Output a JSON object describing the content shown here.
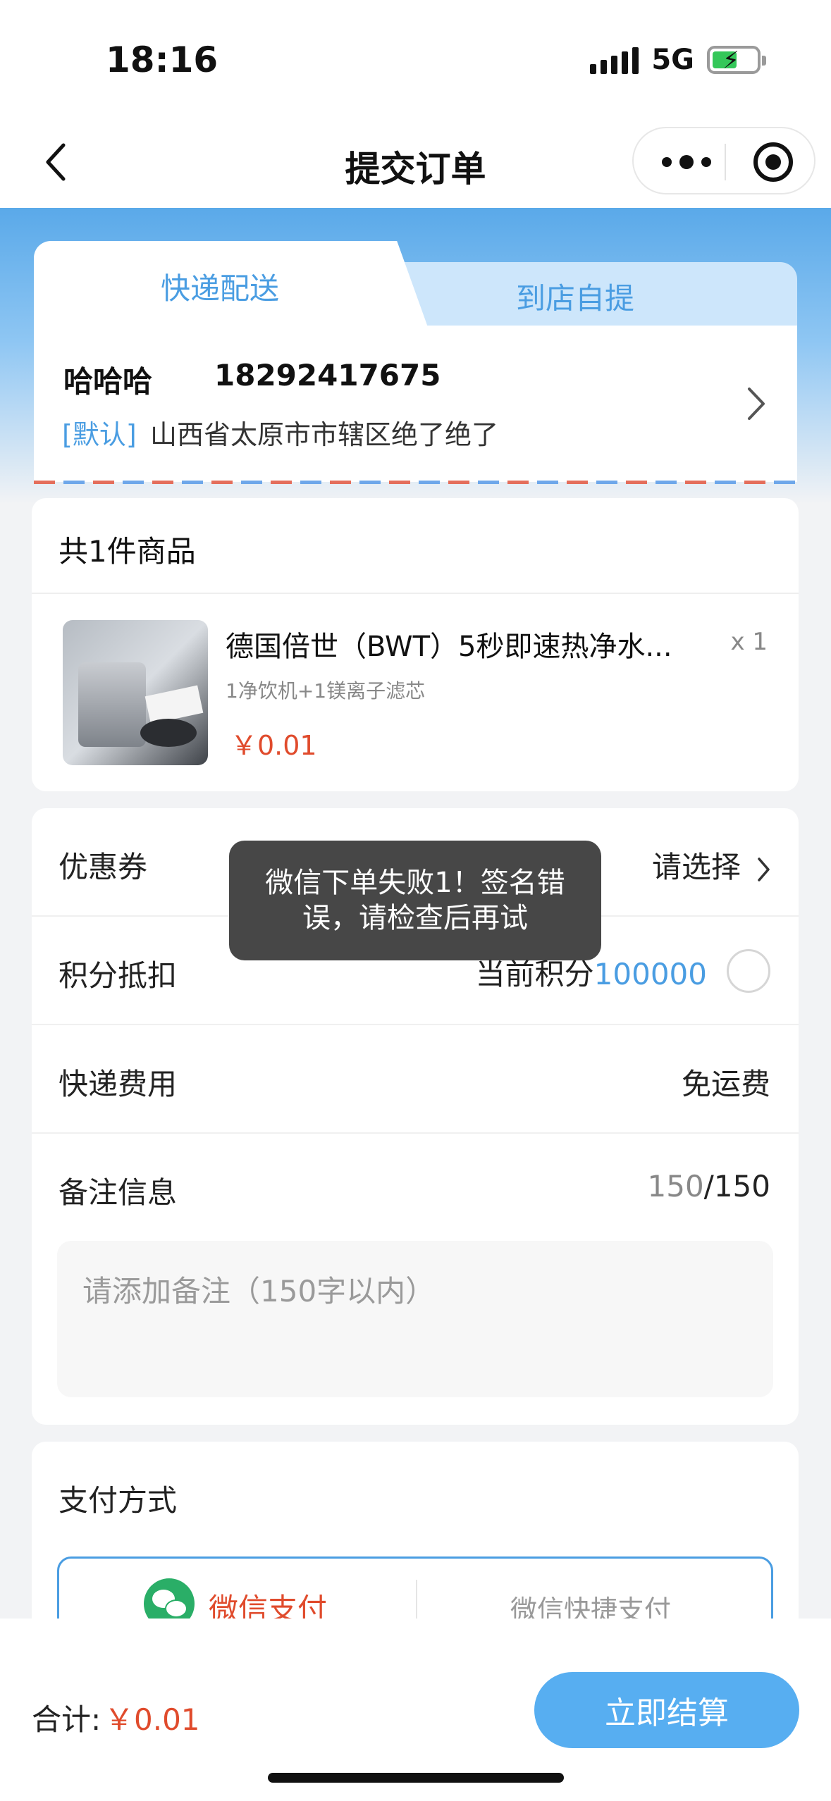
{
  "status_bar": {
    "time": "18:16",
    "network": "5G"
  },
  "nav": {
    "title": "提交订单"
  },
  "delivery_tabs": [
    {
      "label": "快递配送",
      "active": true
    },
    {
      "label": "到店自提",
      "active": false
    }
  ],
  "address": {
    "name": "哈哈哈",
    "phone": "18292417675",
    "tag": "[默认]",
    "text": "山西省太原市市辖区绝了绝了"
  },
  "goods": {
    "count_label": "共1件商品",
    "items": [
      {
        "name": "德国倍世（BWT）5秒即速热净水...",
        "qty": "x 1",
        "spec": "1净饮机+1镁离子滤芯",
        "price": "￥0.01"
      }
    ]
  },
  "options": {
    "coupon": {
      "label": "优惠券",
      "value": "请选择"
    },
    "points": {
      "label": "积分抵扣",
      "prefix": "当前积分",
      "value": "100000"
    },
    "shipping": {
      "label": "快递费用",
      "value": "免运费"
    },
    "remark": {
      "label": "备注信息",
      "count": "150",
      "max": "/150",
      "placeholder": "请添加备注（150字以内）"
    }
  },
  "payment": {
    "title": "支付方式",
    "methods": [
      {
        "label": "微信支付",
        "selected": true
      },
      {
        "label": "微信快捷支付",
        "selected": false
      }
    ]
  },
  "footer": {
    "total_label": "合计:",
    "total_value": "￥0.01",
    "checkout_label": "立即结算"
  },
  "toast": {
    "message": "微信下单失败1！签名错误，请检查后再试"
  },
  "colors": {
    "accent": "#4a9de2",
    "price": "#e04b2c",
    "button": "#57aef1",
    "wechat": "#2aae67"
  }
}
